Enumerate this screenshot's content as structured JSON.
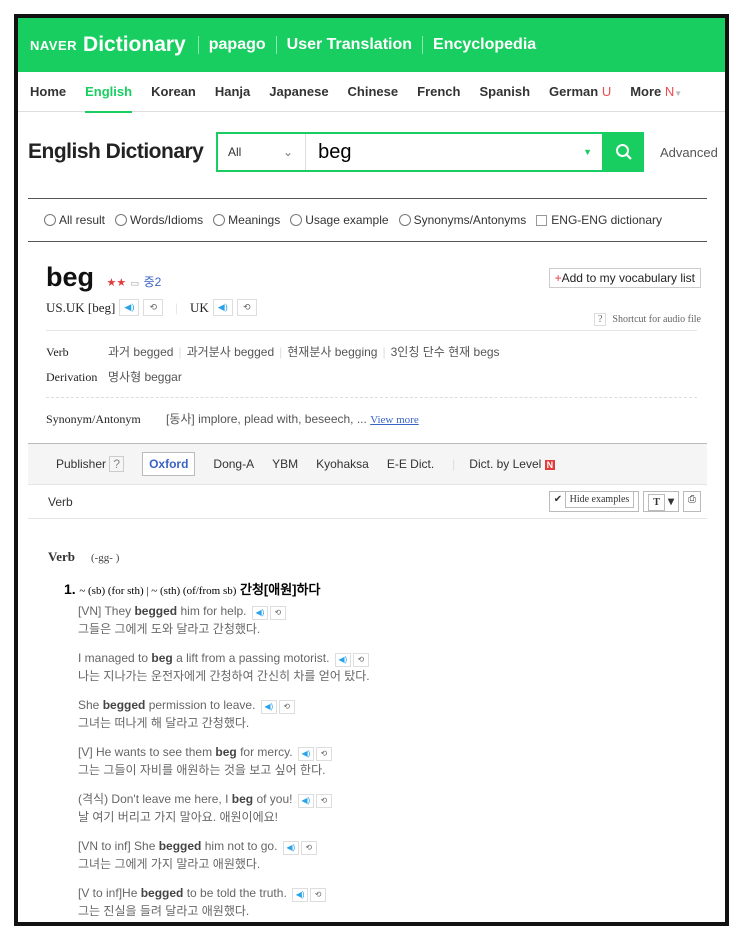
{
  "header": {
    "logo": "NAVER",
    "title": "Dictionary",
    "links": [
      "papago",
      "User Translation",
      "Encyclopedia"
    ]
  },
  "nav": {
    "items": [
      "Home",
      "English",
      "Korean",
      "Hanja",
      "Japanese",
      "Chinese",
      "French",
      "Spanish",
      "German",
      "More"
    ],
    "badges": {
      "German": "U",
      "More": "N"
    }
  },
  "search": {
    "title": "English Dictionary",
    "scope": "All",
    "query": "beg",
    "advanced": "Advanced"
  },
  "filters": [
    "All result",
    "Words/Idioms",
    "Meanings",
    "Usage example",
    "Synonyms/Antonyms"
  ],
  "eng_eng": "ENG-ENG dictionary",
  "entry": {
    "word": "beg",
    "stars": "★★",
    "level": "중2",
    "add_vocab": "Add to my vocabulary list",
    "us_uk": "US.UK [beg]",
    "uk": "UK",
    "shortcut": "Shortcut for audio file",
    "verb_label": "Verb",
    "forms": [
      "과거 begged",
      "과거분사 begged",
      "현재분사 begging",
      "3인칭 단수 현재 begs"
    ],
    "derivation_label": "Derivation",
    "derivation": "명사형 beggar",
    "synonym_label": "Synonym/Antonym",
    "synonyms": "[동사] implore, plead with, beseech, ...",
    "view_more": "View more"
  },
  "publisher": {
    "label": "Publisher",
    "items": [
      "Oxford",
      "Dong-A",
      "YBM",
      "Kyohaksa",
      "E-E Dict.",
      "Dict. by Level"
    ],
    "active": "Oxford"
  },
  "verb_bar": {
    "label": "Verb",
    "hide_examples": "Hide examples",
    "font": "T"
  },
  "content": {
    "pos": "Verb",
    "gg": "(-gg-  )",
    "sense": {
      "num": "1.",
      "pattern": "~ (sb) (for sth) | ~ (sth) (of/from sb)",
      "meaning": "간청[애원]하다"
    },
    "examples": [
      {
        "pre": "[VN] They ",
        "bold": "begged",
        "post": " him for help.",
        "ko": "그들은 그에게 도와 달라고 간청했다."
      },
      {
        "pre": "I managed to ",
        "bold": "beg",
        "post": " a lift from a passing motorist.",
        "ko": "나는 지나가는 운전자에게 간청하여 간신히 차를 얻어 탔다."
      },
      {
        "pre": "She ",
        "bold": "begged",
        "post": " permission to leave.",
        "ko": "그녀는 떠나게 해 달라고 간청했다."
      },
      {
        "pre": "[V] He wants to see them ",
        "bold": "beg",
        "post": " for mercy.",
        "ko": "그는 그들이 자비를 애원하는 것을 보고 싶어 한다."
      },
      {
        "pre": "(격식) Don't leave me here, I ",
        "bold": "beg",
        "post": " of you!",
        "ko": "날 여기 버리고 가지 말아요. 애원이에요!"
      },
      {
        "pre": "[VN to inf] She ",
        "bold": "begged",
        "post": " him not to go.",
        "ko": "그녀는 그에게 가지 말라고 애원했다."
      },
      {
        "pre": "[V to inf]He ",
        "bold": "begged",
        "post": " to be told the truth.",
        "ko": "그는 진실을 들려 달라고 애원했다."
      }
    ]
  },
  "colors": {
    "brand": "#19ce60",
    "link": "#3963c6"
  }
}
